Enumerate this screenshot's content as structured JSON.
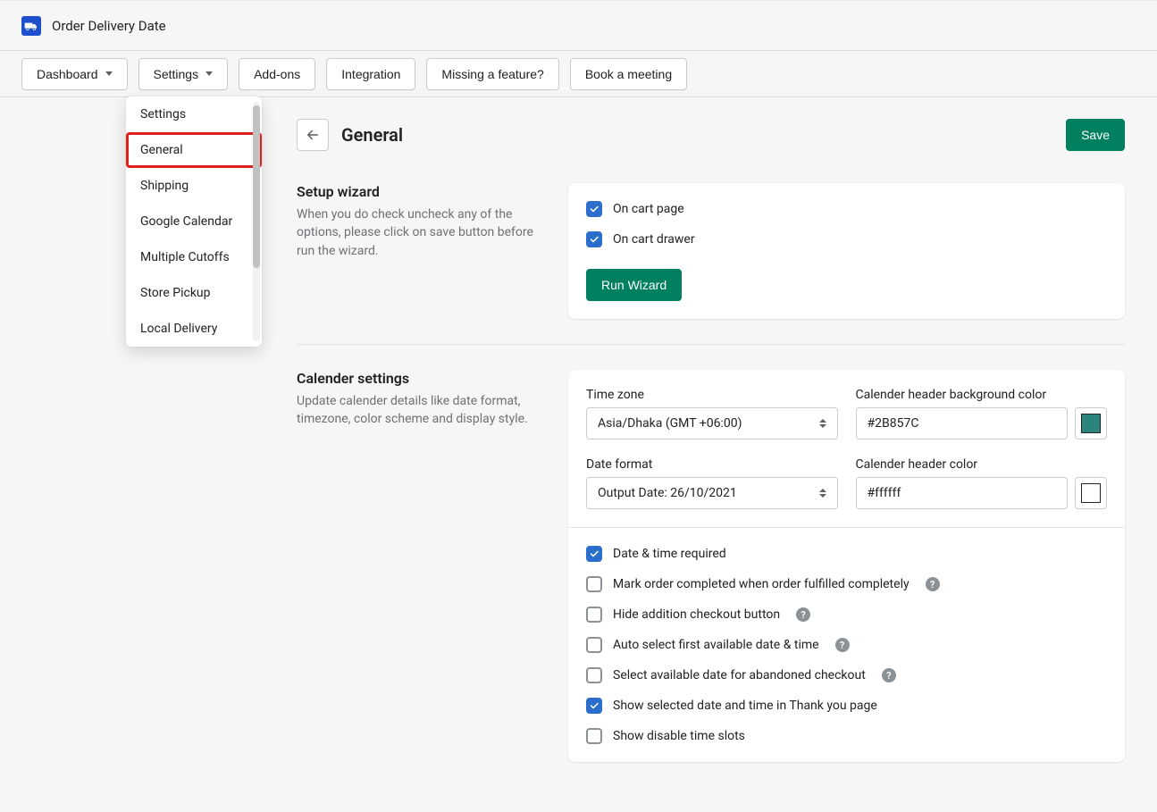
{
  "header": {
    "app_title": "Order Delivery Date"
  },
  "nav": {
    "dashboard": "Dashboard",
    "settings": "Settings",
    "addons": "Add-ons",
    "integration": "Integration",
    "missing": "Missing a feature?",
    "book": "Book a meeting"
  },
  "dropdown": {
    "items": [
      "Settings",
      "General",
      "Shipping",
      "Google Calendar",
      "Multiple Cutoffs",
      "Store Pickup",
      "Local Delivery"
    ],
    "highlight_index": 1
  },
  "page": {
    "title": "General",
    "save": "Save"
  },
  "setup": {
    "heading": "Setup wizard",
    "desc": "When you do check uncheck any of the options, please click on save button before run the wizard.",
    "opts": {
      "cart_page": "On cart page",
      "cart_drawer": "On cart drawer"
    },
    "run_btn": "Run Wizard"
  },
  "calendar": {
    "heading": "Calender settings",
    "desc": "Update calender details like date format, timezone, color scheme and display style.",
    "tz_label": "Time zone",
    "tz_value": "Asia/Dhaka  (GMT +06:00)",
    "df_label": "Date format",
    "df_value": "Output Date: 26/10/2021",
    "hbg_label": "Calender header background color",
    "hbg_value": "#2B857C",
    "hc_label": "Calender header color",
    "hc_value": "#ffffff",
    "opts": {
      "req": "Date & time required",
      "mark": "Mark order completed when order fulfilled completely",
      "hide": "Hide addition checkout button",
      "auto": "Auto select first available date & time",
      "aband": "Select available date for abandoned checkout",
      "thank": "Show selected date and time in Thank you page",
      "disable": "Show disable time slots"
    }
  },
  "colors": {
    "swatch1": "#2B857C",
    "swatch2": "#ffffff"
  }
}
